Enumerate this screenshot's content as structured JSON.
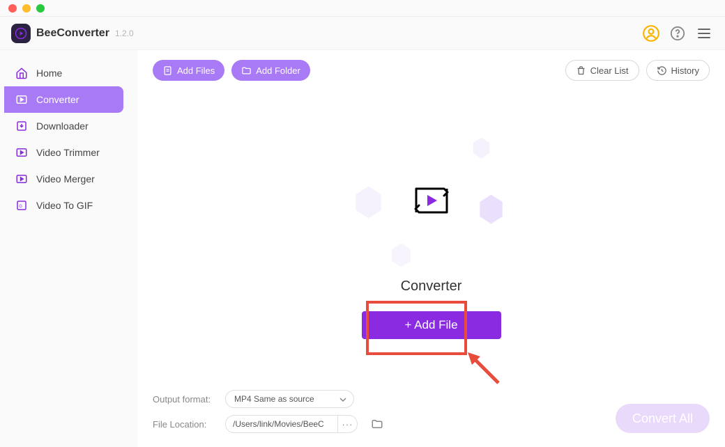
{
  "app": {
    "name": "BeeConverter",
    "version": "1.2.0"
  },
  "sidebar": {
    "items": [
      {
        "label": "Home"
      },
      {
        "label": "Converter"
      },
      {
        "label": "Downloader"
      },
      {
        "label": "Video Trimmer"
      },
      {
        "label": "Video Merger"
      },
      {
        "label": "Video To GIF"
      }
    ]
  },
  "toolbar": {
    "add_files": "Add Files",
    "add_folder": "Add Folder",
    "clear_list": "Clear List",
    "history": "History"
  },
  "center": {
    "title": "Converter",
    "add_file": "+ Add File"
  },
  "footer": {
    "output_label": "Output format:",
    "output_value": "MP4 Same as source",
    "location_label": "File Location:",
    "location_value": "/Users/link/Movies/BeeC",
    "more": "···",
    "convert_all": "Convert All"
  }
}
